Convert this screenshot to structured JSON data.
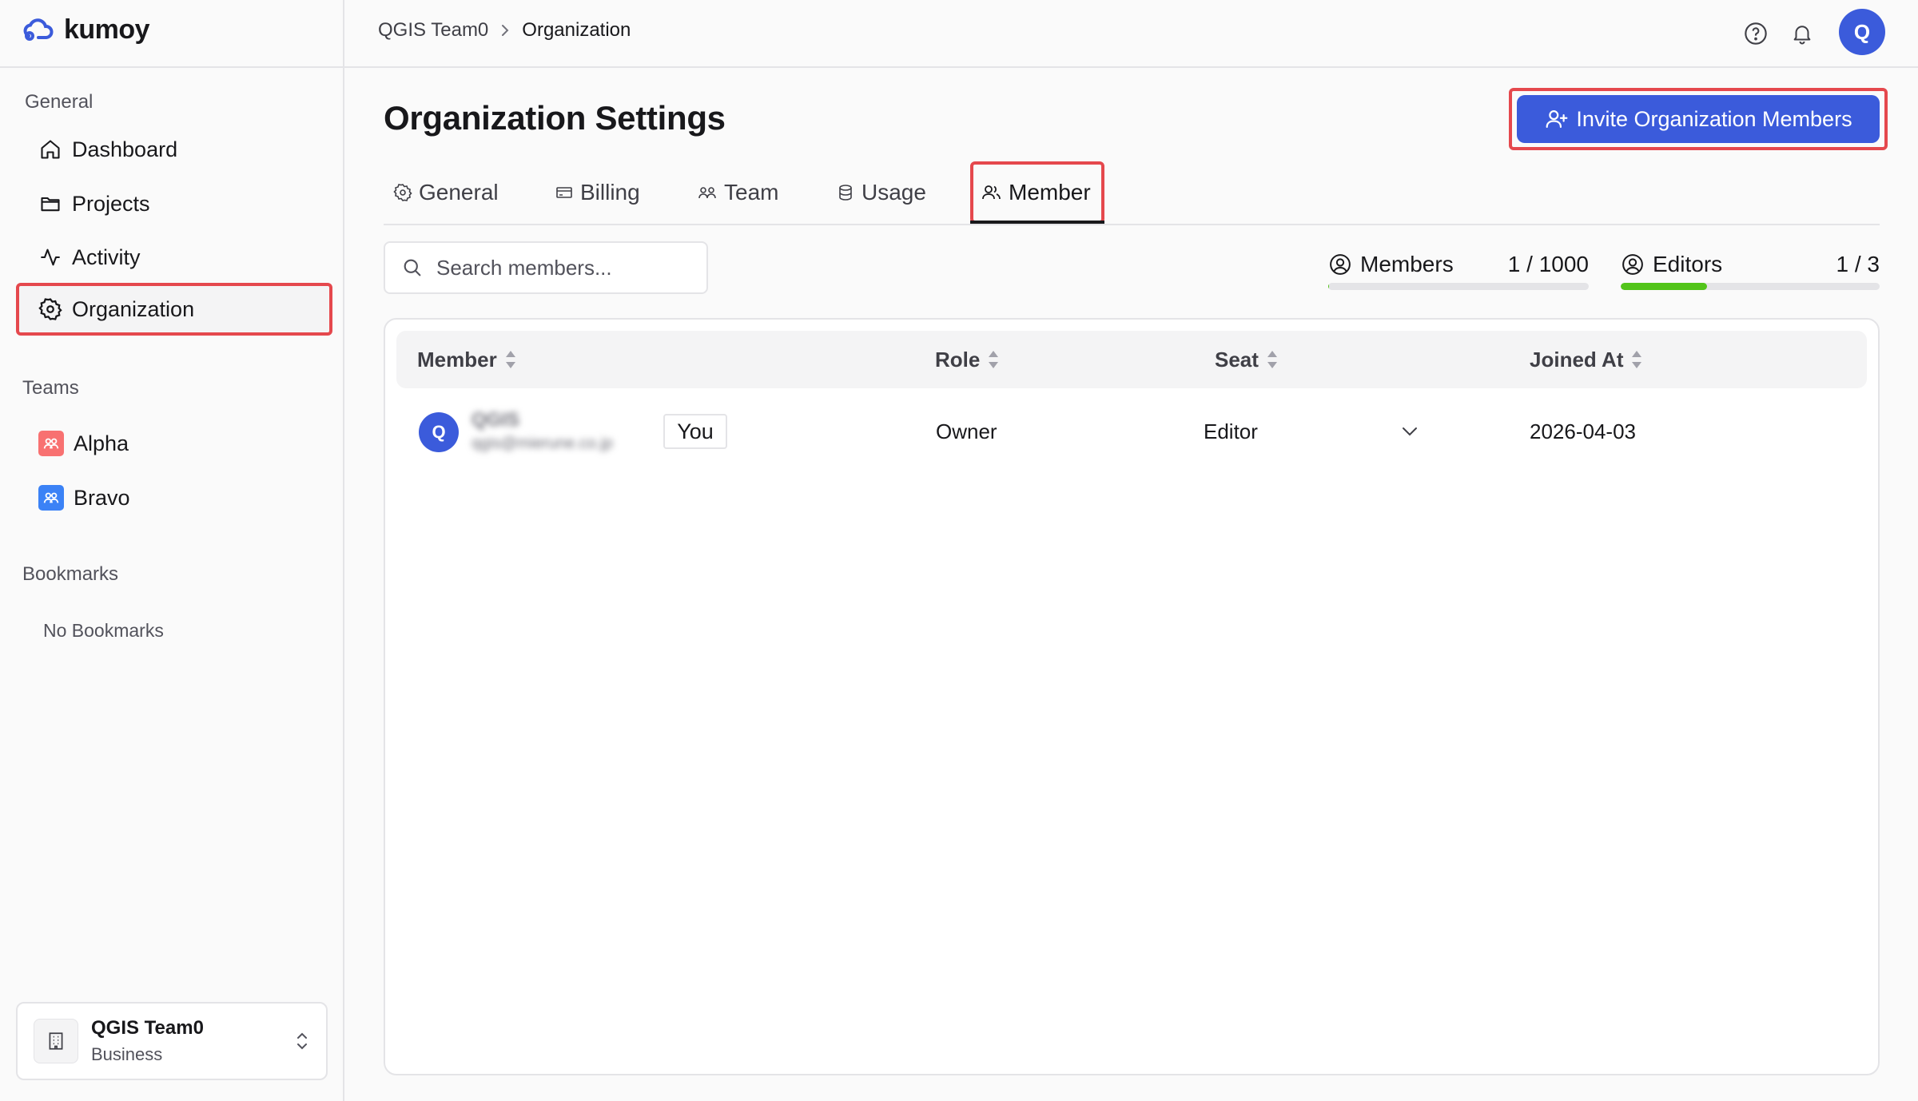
{
  "app": {
    "logo_text": "kumoy"
  },
  "sidebar": {
    "general_heading": "General",
    "nav": [
      {
        "label": "Dashboard",
        "icon": "home-icon"
      },
      {
        "label": "Projects",
        "icon": "folder-icon"
      },
      {
        "label": "Activity",
        "icon": "activity-icon"
      },
      {
        "label": "Organization",
        "icon": "gear-icon",
        "active": true
      }
    ],
    "teams_heading": "Teams",
    "teams": [
      {
        "label": "Alpha",
        "color": "#f87171"
      },
      {
        "label": "Bravo",
        "color": "#3b82f6"
      }
    ],
    "bookmarks_heading": "Bookmarks",
    "bookmarks_empty": "No Bookmarks",
    "org_switcher": {
      "name": "QGIS Team0",
      "plan": "Business"
    }
  },
  "topbar": {
    "breadcrumb": [
      "QGIS Team0",
      "Organization"
    ],
    "avatar_initial": "Q"
  },
  "page": {
    "title": "Organization Settings",
    "invite_label": "Invite Organization Members",
    "tabs": [
      "General",
      "Billing",
      "Team",
      "Usage",
      "Member"
    ],
    "active_tab": "Member",
    "search_placeholder": "Search members...",
    "stats": {
      "members_label": "Members",
      "members_value": "1 / 1000",
      "members_fraction": 0.001,
      "editors_label": "Editors",
      "editors_value": "1 / 3",
      "editors_fraction": 0.333
    },
    "table": {
      "headers": [
        "Member",
        "Role",
        "Seat",
        "Joined At"
      ],
      "rows": [
        {
          "avatar_initial": "Q",
          "name": "QGIS",
          "email": "qgis@mierune.co.jp",
          "you_badge": "You",
          "role": "Owner",
          "seat": "Editor",
          "joined_at": "2026-04-03"
        }
      ]
    }
  },
  "colors": {
    "accent": "#3b5bdb",
    "highlight": "#e5484d",
    "progress": "#52c41a"
  }
}
